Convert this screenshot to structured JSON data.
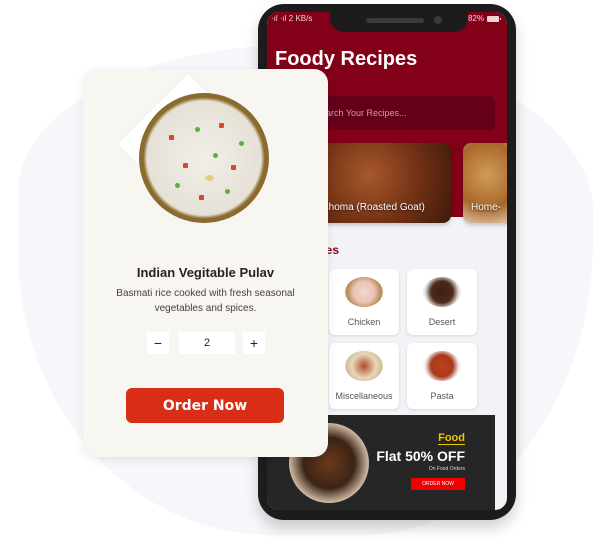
{
  "phone": {
    "status_bar": {
      "left": "·ıl ·ıl 2 KB/s",
      "battery_percent": "82%"
    },
    "app_title": "Foody Recipes",
    "search": {
      "placeholder": "Search Your Recipes..."
    },
    "recipes": [
      {
        "name": "Nyama Choma (Roasted Goat)"
      },
      {
        "name": "Home-"
      }
    ],
    "categories_title": "Categories",
    "categories": [
      {
        "label": ""
      },
      {
        "label": "Chicken"
      },
      {
        "label": "Desert"
      },
      {
        "label": ""
      },
      {
        "label": "Miscellaneous"
      },
      {
        "label": "Pasta"
      }
    ],
    "promo": {
      "tag": "Food",
      "headline": "Flat 50% OFF",
      "subtext": "On Food Orders",
      "button": "ORDER NOW"
    }
  },
  "product": {
    "name": "Indian Vegitable Pulav",
    "description": "Basmati rice cooked with fresh seasonal vegetables and spices.",
    "quantity": "2",
    "minus_label": "−",
    "plus_label": "+",
    "order_button": "Order Now"
  },
  "colors": {
    "brand": "#830019",
    "order_button": "#d82e18",
    "promo_accent": "#f2c400"
  }
}
